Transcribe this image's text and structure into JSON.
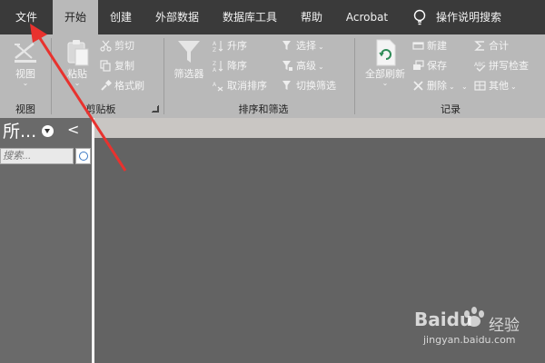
{
  "tabs": [
    {
      "label": "文件",
      "active": false
    },
    {
      "label": "开始",
      "active": true
    },
    {
      "label": "创建",
      "active": false
    },
    {
      "label": "外部数据",
      "active": false
    },
    {
      "label": "数据库工具",
      "active": false
    },
    {
      "label": "帮助",
      "active": false
    },
    {
      "label": "Acrobat",
      "active": false
    },
    {
      "label": "操作说明搜索",
      "active": false
    }
  ],
  "ribbon": {
    "groups": {
      "view": "视图",
      "clipboard": "剪贴板",
      "sort_filter": "排序和筛选",
      "records": "记录"
    },
    "view_btn": "视图",
    "paste_btn": "粘贴",
    "cut": "剪切",
    "copy": "复制",
    "format_painter": "格式刷",
    "filter_btn": "筛选器",
    "ascending": "升序",
    "descending": "降序",
    "clear_sort": "取消排序",
    "selection": "选择",
    "advanced": "高级",
    "toggle_filter": "切换筛选",
    "refresh_all": "全部刷新",
    "new": "新建",
    "save": "保存",
    "delete": "删除",
    "totals": "合计",
    "spelling": "拼写检查",
    "more": "其他"
  },
  "nav": {
    "title": "所...",
    "search_placeholder": "搜索..."
  },
  "watermark": {
    "brand": "Baidu",
    "cn": "经验",
    "url": "jingyan.baidu.com"
  },
  "colors": {
    "tabbar_bg": "#3a3a3a",
    "ribbon_bg": "#b9b9b9",
    "workspace_bg": "#636363",
    "arrow": "#e8322e"
  }
}
